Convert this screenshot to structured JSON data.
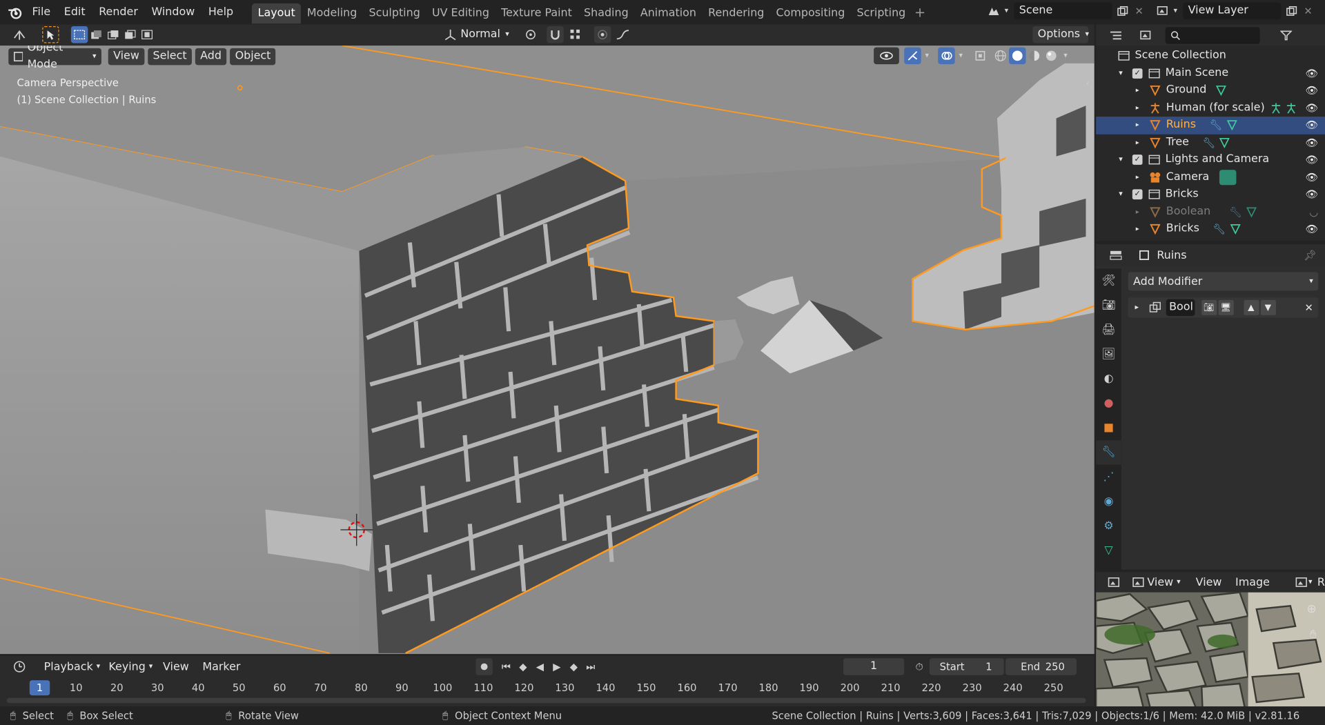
{
  "topbar": {
    "menus": [
      "File",
      "Edit",
      "Render",
      "Window",
      "Help"
    ],
    "workspaces": [
      "Layout",
      "Modeling",
      "Sculpting",
      "UV Editing",
      "Texture Paint",
      "Shading",
      "Animation",
      "Rendering",
      "Compositing",
      "Scripting"
    ],
    "active_workspace": "Layout",
    "scene_name": "Scene",
    "view_layer_name": "View Layer",
    "add_workspace": "+"
  },
  "viewport_header": {
    "orientation": "Normal",
    "options_label": "Options",
    "mode": "Object Mode",
    "menus": [
      "View",
      "Select",
      "Add",
      "Object"
    ]
  },
  "viewport": {
    "camera_label": "Camera Perspective",
    "collection_label": "(1) Scene Collection | Ruins"
  },
  "outliner": {
    "root": "Scene Collection",
    "rows": [
      {
        "name": "Main Scene",
        "kind": "collection",
        "indent": 1,
        "selected": false,
        "dim": false
      },
      {
        "name": "Ground",
        "kind": "mesh",
        "indent": 2,
        "selected": false,
        "dim": false
      },
      {
        "name": "Human (for scale)",
        "kind": "armature",
        "indent": 2,
        "selected": false,
        "dim": false
      },
      {
        "name": "Ruins",
        "kind": "mesh",
        "indent": 2,
        "selected": true,
        "dim": false
      },
      {
        "name": "Tree",
        "kind": "mesh",
        "indent": 2,
        "selected": false,
        "dim": false
      },
      {
        "name": "Lights and Camera",
        "kind": "collection",
        "indent": 1,
        "selected": false,
        "dim": false
      },
      {
        "name": "Camera",
        "kind": "camera",
        "indent": 2,
        "selected": false,
        "dim": false
      },
      {
        "name": "Bricks",
        "kind": "collection",
        "indent": 1,
        "selected": false,
        "dim": false
      },
      {
        "name": "Boolean",
        "kind": "mesh",
        "indent": 2,
        "selected": false,
        "dim": true
      },
      {
        "name": "Bricks",
        "kind": "mesh",
        "indent": 2,
        "selected": false,
        "dim": false
      }
    ]
  },
  "properties": {
    "object_name": "Ruins",
    "add_modifier_label": "Add Modifier",
    "modifier_name": "Bool"
  },
  "image_editor": {
    "menus": [
      "View",
      "View",
      "Image"
    ],
    "right_clip": "R"
  },
  "timeline": {
    "menus": [
      "Playback",
      "Keying",
      "View",
      "Marker"
    ],
    "current_frame": "1",
    "start_label": "Start",
    "start_value": "1",
    "end_label": "End",
    "end_value": "250",
    "ruler": [
      "1",
      "10",
      "20",
      "30",
      "40",
      "50",
      "60",
      "70",
      "80",
      "90",
      "100",
      "110",
      "120",
      "130",
      "140",
      "150",
      "160",
      "170",
      "180",
      "190",
      "200",
      "210",
      "220",
      "230",
      "240",
      "250"
    ]
  },
  "statusbar": {
    "select": "Select",
    "box_select": "Box Select",
    "rotate_view": "Rotate View",
    "context_menu": "Object Context Menu",
    "stats": "Scene Collection | Ruins | Verts:3,609 | Faces:3,641 | Tris:7,029 | Objects:1/6 | Mem: 42.0 MiB | v2.81.16"
  },
  "colors": {
    "selection_outline": "#ff9a1f",
    "active_row": "#334d80",
    "mesh_icon": "#e8852c",
    "modifier_icon": "#5fa8d3",
    "data_icon": "#3fc9a0",
    "viewport_bg": "#8a8a8a"
  }
}
